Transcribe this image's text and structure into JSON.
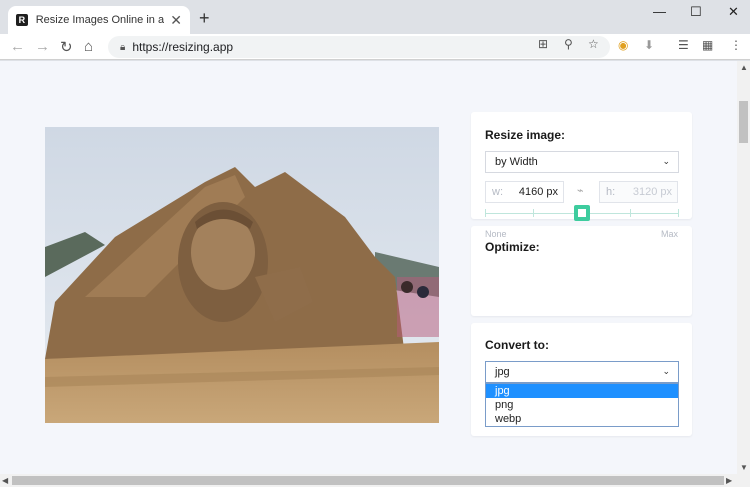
{
  "browser": {
    "tab_title": "Resize Images Online in a Click",
    "favicon_letter": "R",
    "new_tab": "+",
    "close_tab": "✕",
    "url": "https://resizing.app",
    "window": {
      "minimize": "—",
      "maximize": "☐",
      "close": "✕"
    }
  },
  "resize": {
    "title": "Resize image:",
    "mode": "by Width",
    "width_label": "w:",
    "width_value": "4160 px",
    "height_label": "h:",
    "height_value": "3120 px"
  },
  "optimize": {
    "title": "Optimize:",
    "level": 0.5,
    "min_label": "None",
    "max_label": "Max"
  },
  "convert": {
    "title": "Convert to:",
    "selected": "jpg",
    "options": [
      "jpg",
      "png",
      "webp"
    ]
  },
  "colors": {
    "accent": "#3ecc9e",
    "dropdown_highlight": "#1e90ff",
    "page_bg": "#f4f6fb"
  },
  "icons": [
    "back-arrow-icon",
    "forward-arrow-icon",
    "reload-icon",
    "home-icon",
    "lock-icon",
    "translate-icon",
    "zoom-icon",
    "star-icon",
    "chrome-extension-icon",
    "download-icon",
    "reading-list-icon",
    "calendar-icon",
    "menu-icon"
  ]
}
